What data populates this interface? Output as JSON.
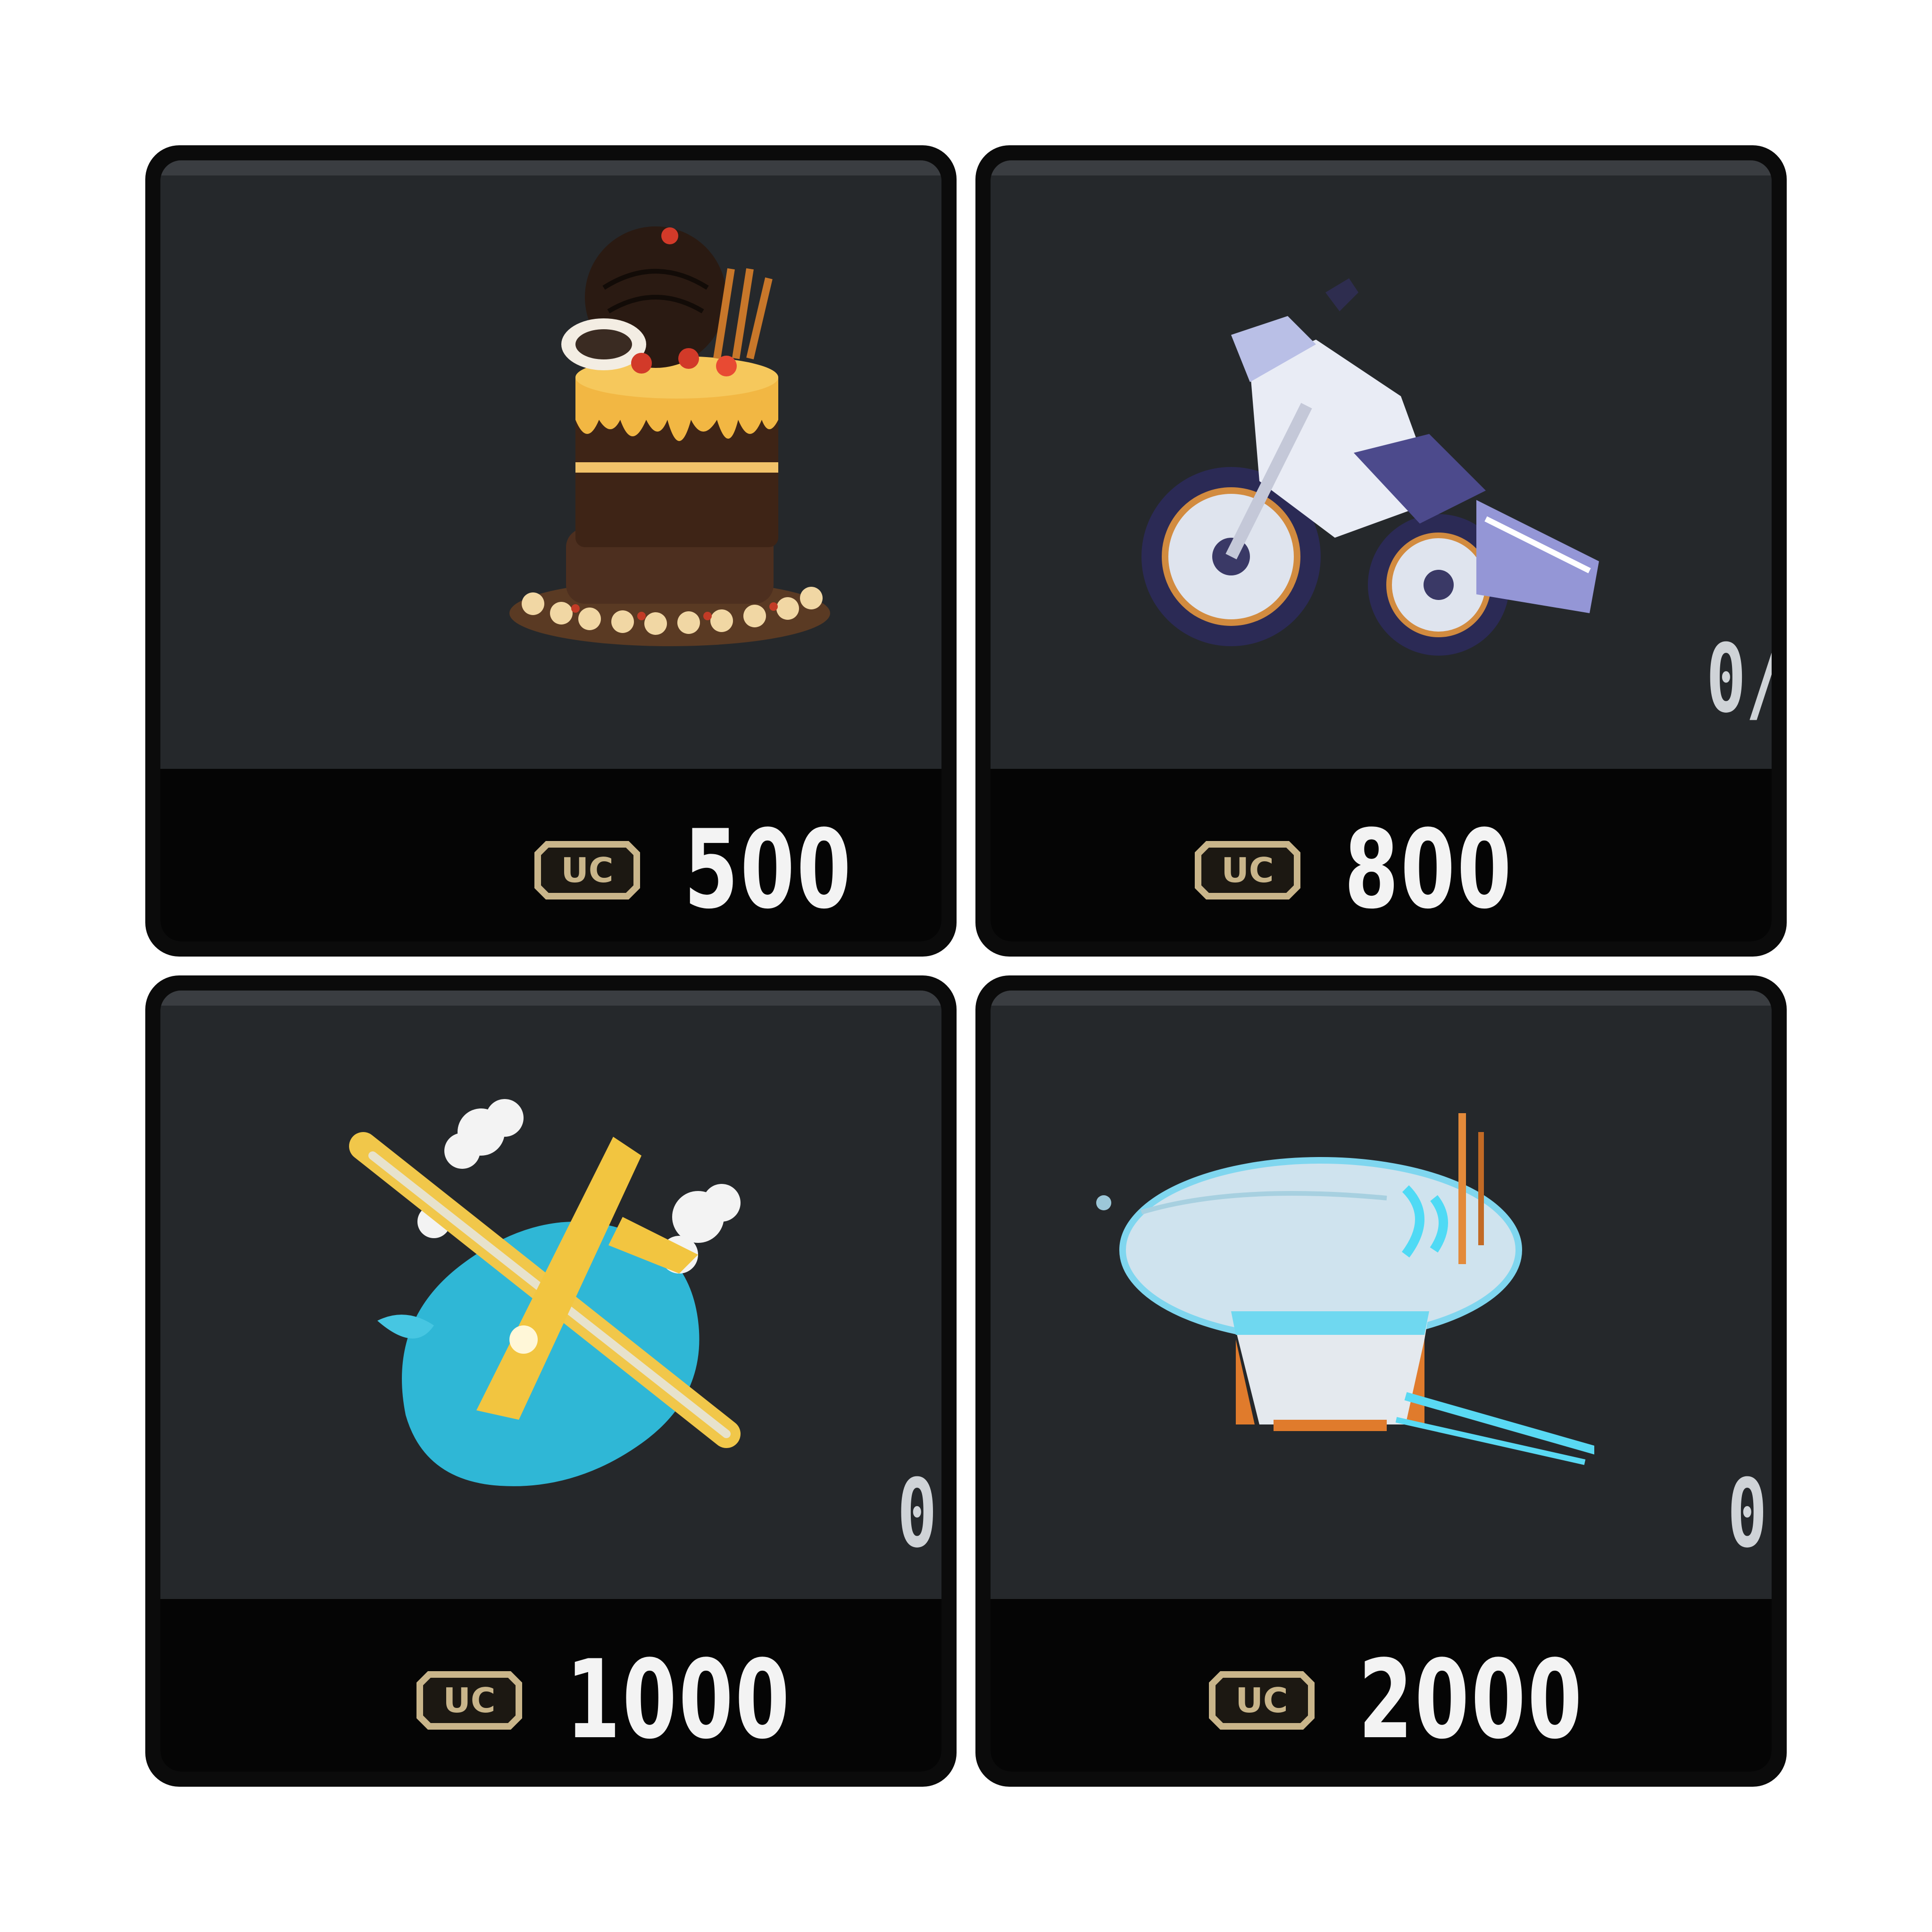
{
  "items": [
    {
      "name": "cake",
      "price": "500",
      "count": ""
    },
    {
      "name": "motorcycle",
      "price": "800",
      "count": "0/"
    },
    {
      "name": "airplane",
      "price": "1000",
      "count": "0"
    },
    {
      "name": "airship",
      "price": "2000",
      "count": "0"
    }
  ],
  "currency": {
    "icon": "uc-currency-icon",
    "label": "UC"
  },
  "colors": {
    "tile_bg": "#242629",
    "price_bar_bg": "#050505",
    "price_text": "#f3f3f3",
    "uc_icon": "#c9b58a"
  }
}
